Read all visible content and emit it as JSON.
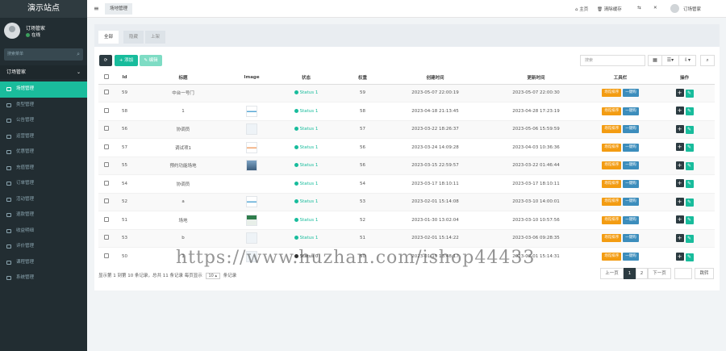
{
  "brand": "演示站点",
  "user": {
    "name": "订场管家",
    "status": "在线"
  },
  "sidebar": {
    "search_placeholder": "搜索菜单",
    "group_label": "订场管家",
    "items": [
      {
        "label": "场馆管理",
        "active": true
      },
      {
        "label": "类型管理",
        "active": false
      },
      {
        "label": "公告管理",
        "active": false
      },
      {
        "label": "运营管理",
        "active": false
      },
      {
        "label": "优惠管理",
        "active": false
      },
      {
        "label": "充值管理",
        "active": false
      },
      {
        "label": "订单管理",
        "active": false
      },
      {
        "label": "活动管理",
        "active": false
      },
      {
        "label": "退款管理",
        "active": false
      },
      {
        "label": "收益明细",
        "active": false
      },
      {
        "label": "评价管理",
        "active": false
      },
      {
        "label": "课程管理",
        "active": false
      },
      {
        "label": "系统管理",
        "active": false
      }
    ]
  },
  "topbar": {
    "tab_label": "场地管理",
    "home": "主页",
    "clear_cache": "清除缓存",
    "user": "订场管家"
  },
  "subtabs": [
    "全部",
    "隐藏",
    "上架"
  ],
  "toolbar": {
    "add": "添加",
    "edit": "编辑",
    "search_placeholder": "搜索"
  },
  "table": {
    "headers": [
      "Id",
      "标题",
      "Image",
      "状态",
      "权重",
      "创建时间",
      "更新时间",
      "工具栏",
      "操作"
    ],
    "rows": [
      {
        "id": "59",
        "title": "中台一号门",
        "thumb": "none",
        "status": "Status 1",
        "weight": "59",
        "created": "2023-05-07 22:00:19",
        "updated": "2023-05-07 22:00:30"
      },
      {
        "id": "58",
        "title": "1",
        "thumb": "blue",
        "status": "Status 1",
        "weight": "58",
        "created": "2023-04-18 21:13:45",
        "updated": "2023-04-28 17:23:19"
      },
      {
        "id": "56",
        "title": "协调员",
        "thumb": "plain",
        "status": "Status 1",
        "weight": "57",
        "created": "2023-03-22 18:26:37",
        "updated": "2023-05-06 15:59:59"
      },
      {
        "id": "57",
        "title": "调试项1",
        "thumb": "stripe",
        "status": "Status 1",
        "weight": "56",
        "created": "2023-03-24 14:09:28",
        "updated": "2023-04-03 10:36:36"
      },
      {
        "id": "55",
        "title": "预约功能场地",
        "thumb": "photo",
        "status": "Status 1",
        "weight": "56",
        "created": "2023-03-15 22:59:57",
        "updated": "2023-03-22 01:46:44"
      },
      {
        "id": "54",
        "title": "协调员",
        "thumb": "none",
        "status": "Status 1",
        "weight": "54",
        "created": "2023-03-17 18:10:11",
        "updated": "2023-03-17 18:10:11"
      },
      {
        "id": "52",
        "title": "a",
        "thumb": "blue",
        "status": "Status 1",
        "weight": "53",
        "created": "2023-02-01 15:14:08",
        "updated": "2023-03-10 14:00:01"
      },
      {
        "id": "51",
        "title": "场地",
        "thumb": "green",
        "status": "Status 1",
        "weight": "52",
        "created": "2023-01-30 13:02:04",
        "updated": "2023-03-10 10:57:56"
      },
      {
        "id": "53",
        "title": "b",
        "thumb": "plain",
        "status": "Status 1",
        "weight": "51",
        "created": "2023-02-01 15:14:22",
        "updated": "2023-03-06 09:28:35"
      },
      {
        "id": "50",
        "title": "1",
        "thumb": "plain",
        "status": "Status 0",
        "weight": "50",
        "created": "2023-01-19 13:48:17",
        "updated": "2023-02-01 15:14:31"
      }
    ],
    "tool_orange": "场馆排序",
    "tool_blue": "一键购"
  },
  "pagination": {
    "info": "显示第 1 到第 10 条记录，总共 11 条记录 每页显示",
    "page_size": "10",
    "per_suffix": "条记录",
    "prev": "上一页",
    "pages": [
      "1",
      "2"
    ],
    "next": "下一页",
    "jump": "跳转"
  },
  "watermark": "https://www.huzhan.com/ishop44433",
  "colors": {
    "sidebar_bg": "#222d32",
    "accent": "#18bc9c",
    "orange": "#f39c12",
    "blue": "#3c8dbc"
  }
}
